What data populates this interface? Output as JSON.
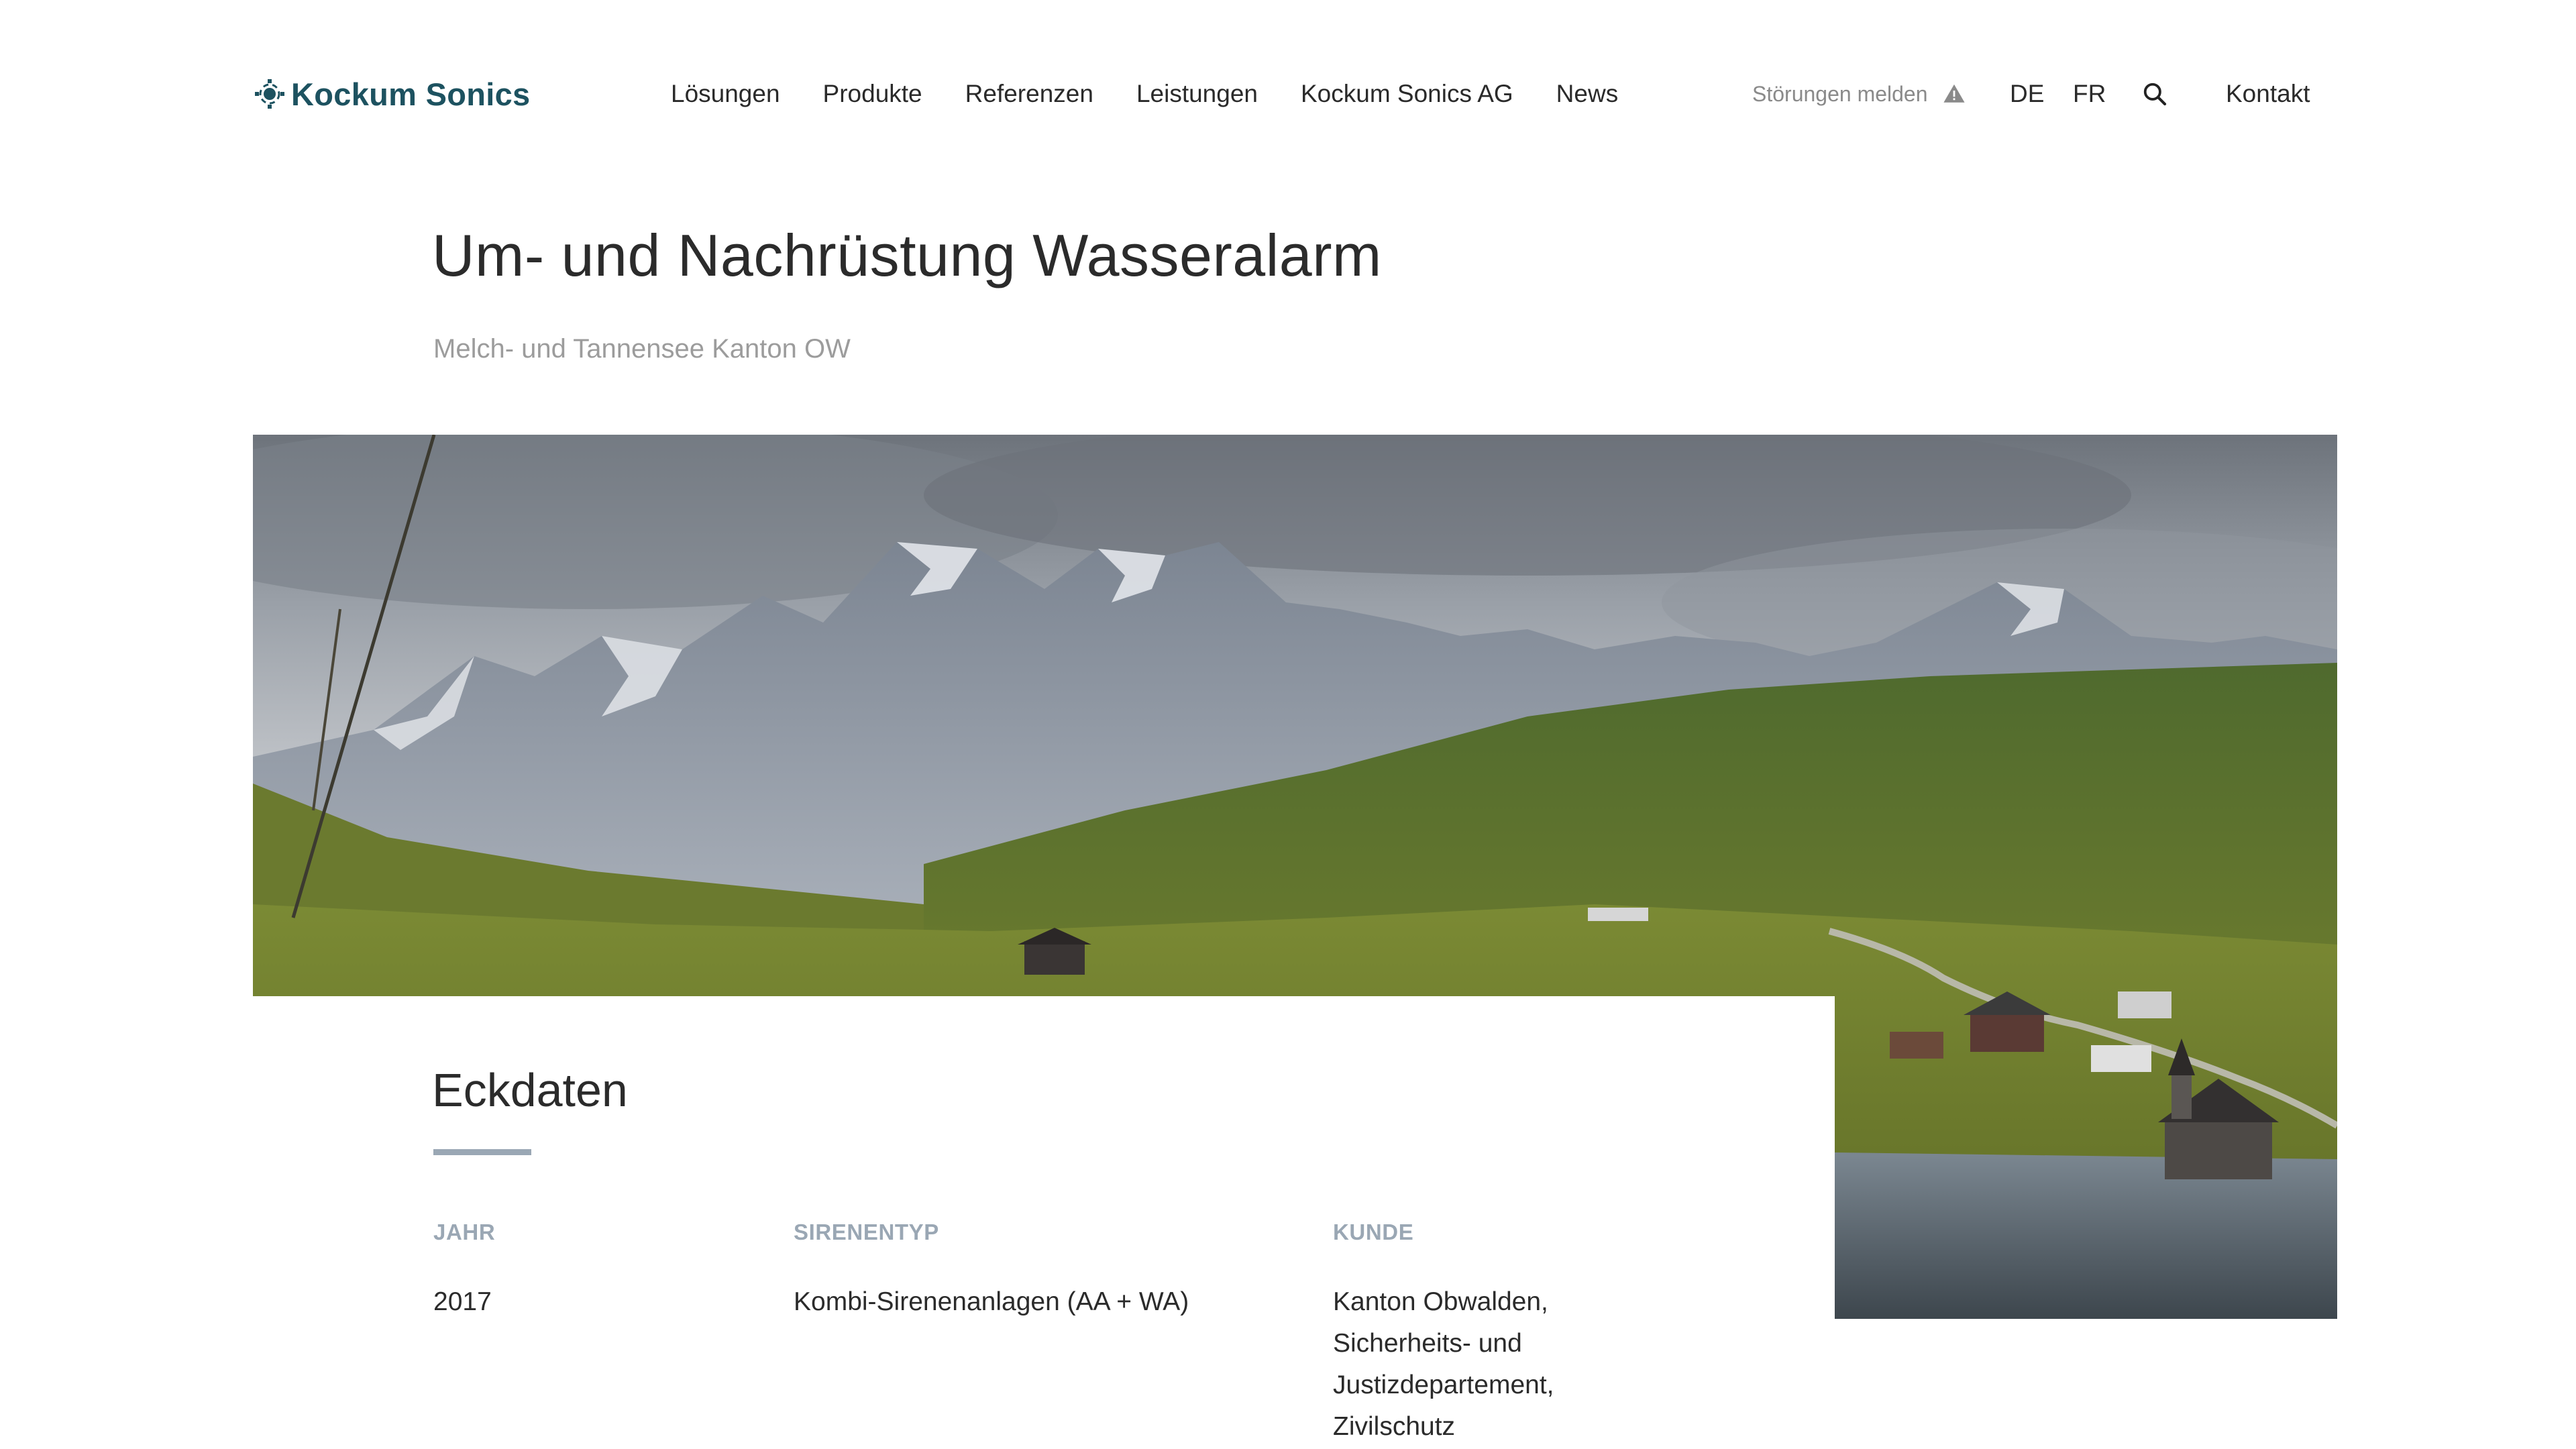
{
  "brand": {
    "name": "Kockum Sonics",
    "color": "#1d5260"
  },
  "nav": {
    "items": [
      {
        "label": "Lösungen"
      },
      {
        "label": "Produkte"
      },
      {
        "label": "Referenzen"
      },
      {
        "label": "Leistungen"
      },
      {
        "label": "Kockum Sonics AG"
      },
      {
        "label": "News"
      }
    ]
  },
  "header_right": {
    "report_label": "Störungen melden",
    "report_icon": "warning-icon",
    "languages": [
      "DE",
      "FR"
    ],
    "search_icon": "search-icon",
    "contact_label": "Kontakt"
  },
  "page": {
    "title": "Um- und Nachrüstung Wasseralarm",
    "subtitle": "Melch- und Tannensee Kanton OW"
  },
  "hero": {
    "description_icon": "landscape-photo"
  },
  "eckdaten": {
    "title": "Eckdaten",
    "columns": [
      {
        "label": "JAHR",
        "lines": [
          "2017"
        ]
      },
      {
        "label": "SIRENENTYP",
        "lines": [
          "Kombi-Sirenenanlagen (AA + WA)"
        ]
      },
      {
        "label": "KUNDE",
        "lines": [
          "Kanton Obwalden,",
          "Sicherheits- und",
          "Justizdepartement,",
          "Zivilschutz"
        ]
      }
    ]
  },
  "colors": {
    "accent_rule": "#9aa7b4",
    "muted_text": "#9c9c9c",
    "body_text": "#2b2b2b"
  }
}
